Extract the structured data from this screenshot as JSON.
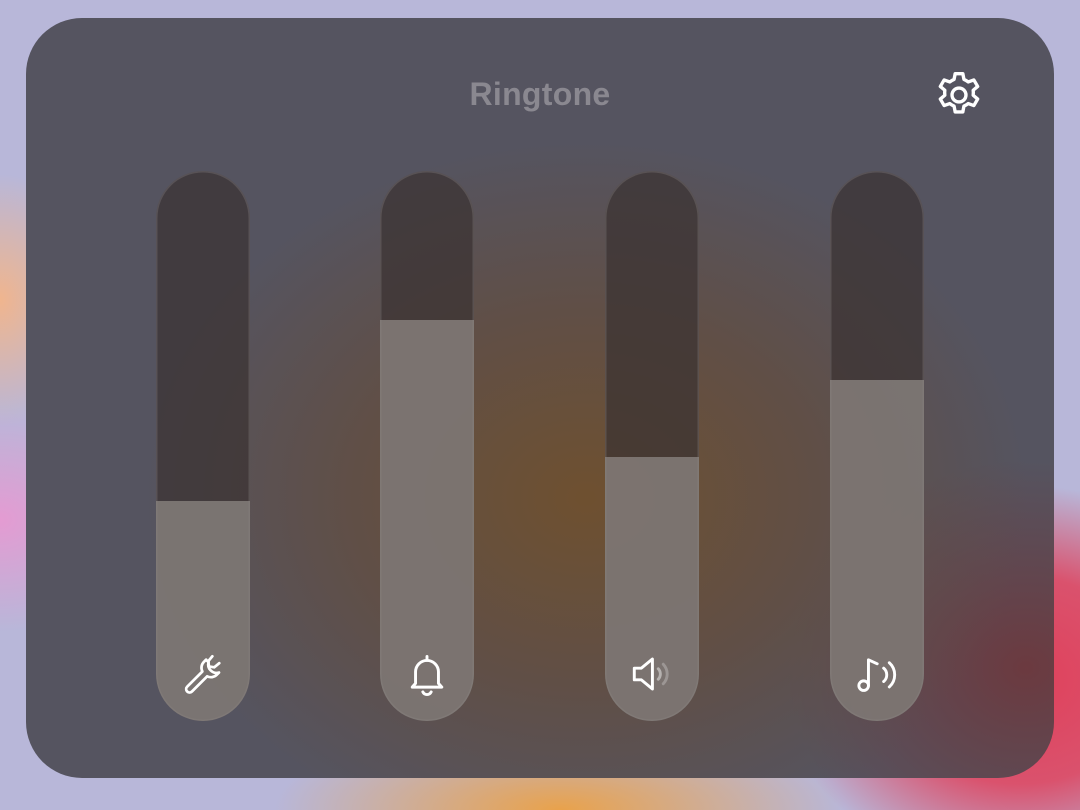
{
  "panel": {
    "title": "Ringtone",
    "settings_icon": "gear-icon"
  },
  "sliders": [
    {
      "id": "system",
      "icon": "wrench-icon",
      "level": 0.4
    },
    {
      "id": "ringtone",
      "icon": "bell-icon",
      "level": 0.73
    },
    {
      "id": "media",
      "icon": "speaker-icon",
      "level": 0.48
    },
    {
      "id": "music",
      "icon": "music-note-icon",
      "level": 0.62
    }
  ],
  "colors": {
    "panel": "#555460",
    "track": "#3a3232",
    "fill": "#8a8480",
    "title": "#8a8890",
    "icon": "#ffffff"
  }
}
